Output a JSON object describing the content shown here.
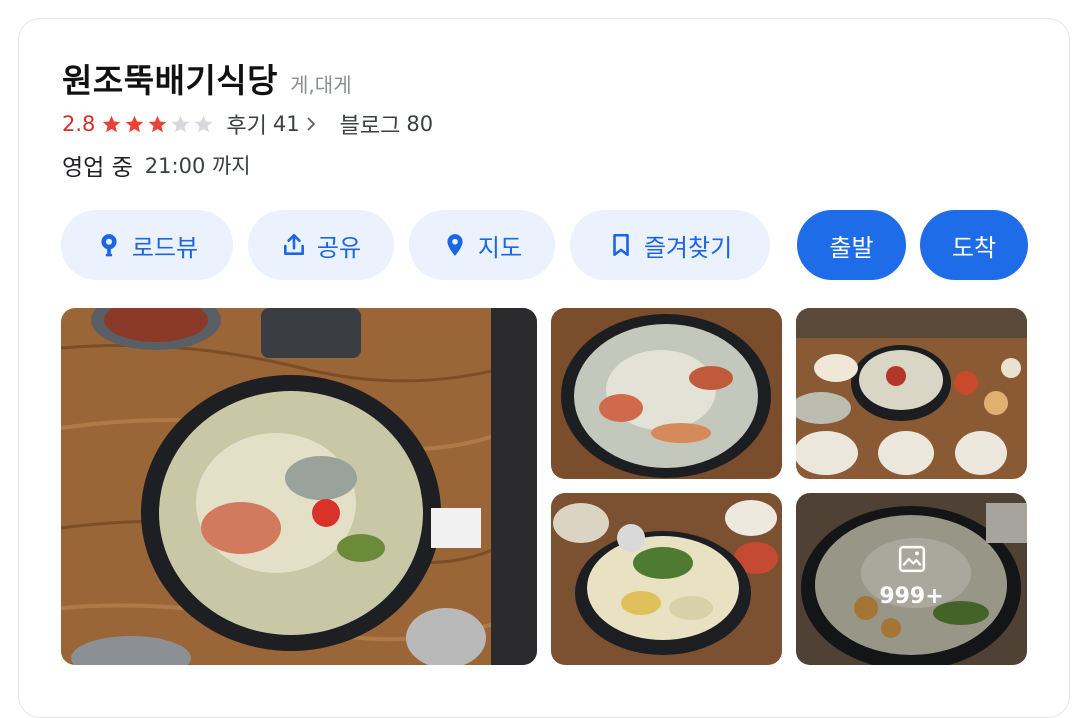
{
  "place": {
    "name": "원조뚝배기식당",
    "category": "게,대게"
  },
  "rating": {
    "score": "2.8",
    "stars": 2.8,
    "reviews_label": "후기",
    "reviews_count": "41",
    "blog_label": "블로그",
    "blog_count": "80"
  },
  "hours": {
    "status": "영업 중",
    "until": "21:00 까지"
  },
  "actions": {
    "roadview": "로드뷰",
    "share": "공유",
    "map": "지도",
    "bookmark": "즐겨찾기",
    "depart": "출발",
    "arrive": "도착"
  },
  "photos": {
    "more_count": "999+"
  },
  "colors": {
    "accent": "#1f6ce8",
    "accent_light": "#ecf2fd",
    "rating": "#d93025",
    "star_on": "#ea4335",
    "star_off": "#d6d8dc"
  }
}
